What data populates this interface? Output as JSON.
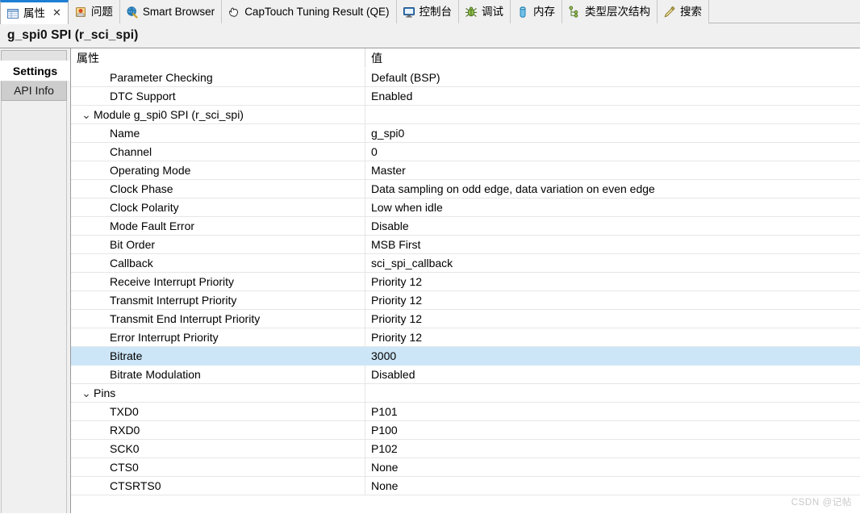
{
  "tabbar": {
    "tabs": [
      {
        "label": "属性",
        "icon": "properties-icon",
        "active": true,
        "closable": true,
        "close_glyph": "✕"
      },
      {
        "label": "问题",
        "icon": "problems-icon",
        "active": false,
        "closable": false
      },
      {
        "label": "Smart Browser",
        "icon": "globe-icon",
        "active": false,
        "closable": false
      },
      {
        "label": "CapTouch Tuning Result (QE)",
        "icon": "hand-pointer-icon",
        "active": false,
        "closable": false
      },
      {
        "label": "控制台",
        "icon": "console-icon",
        "active": false,
        "closable": false
      },
      {
        "label": "调试",
        "icon": "debug-bug-icon",
        "active": false,
        "closable": false
      },
      {
        "label": "内存",
        "icon": "memory-icon",
        "active": false,
        "closable": false
      },
      {
        "label": "类型层次结构",
        "icon": "type-hierarchy-icon",
        "active": false,
        "closable": false
      },
      {
        "label": "搜索",
        "icon": "search-icon",
        "active": false,
        "closable": false
      }
    ]
  },
  "titlebar": {
    "title": "g_spi0 SPI (r_sci_spi)"
  },
  "sidebar": {
    "tabs": [
      {
        "label": "Settings",
        "active": true
      },
      {
        "label": "API Info",
        "active": false
      }
    ]
  },
  "table": {
    "headers": {
      "property": "属性",
      "value": "值"
    },
    "rows": [
      {
        "property": "Parameter Checking",
        "value": "Default (BSP)",
        "level": 1,
        "group": false,
        "selected": false
      },
      {
        "property": "DTC Support",
        "value": "Enabled",
        "level": 1,
        "group": false,
        "selected": false
      },
      {
        "property": "Module g_spi0 SPI (r_sci_spi)",
        "value": "",
        "level": 0,
        "group": true,
        "expanded": true,
        "selected": false
      },
      {
        "property": "Name",
        "value": "g_spi0",
        "level": 1,
        "group": false,
        "selected": false
      },
      {
        "property": "Channel",
        "value": "0",
        "level": 1,
        "group": false,
        "selected": false
      },
      {
        "property": "Operating Mode",
        "value": "Master",
        "level": 1,
        "group": false,
        "selected": false
      },
      {
        "property": "Clock Phase",
        "value": "Data sampling on odd edge, data variation on even edge",
        "level": 1,
        "group": false,
        "selected": false
      },
      {
        "property": "Clock Polarity",
        "value": "Low when idle",
        "level": 1,
        "group": false,
        "selected": false
      },
      {
        "property": "Mode Fault Error",
        "value": "Disable",
        "level": 1,
        "group": false,
        "selected": false
      },
      {
        "property": "Bit Order",
        "value": "MSB First",
        "level": 1,
        "group": false,
        "selected": false
      },
      {
        "property": "Callback",
        "value": "sci_spi_callback",
        "level": 1,
        "group": false,
        "selected": false
      },
      {
        "property": "Receive Interrupt Priority",
        "value": "Priority 12",
        "level": 1,
        "group": false,
        "selected": false
      },
      {
        "property": "Transmit Interrupt Priority",
        "value": "Priority 12",
        "level": 1,
        "group": false,
        "selected": false
      },
      {
        "property": "Transmit End Interrupt Priority",
        "value": "Priority 12",
        "level": 1,
        "group": false,
        "selected": false
      },
      {
        "property": "Error Interrupt Priority",
        "value": "Priority 12",
        "level": 1,
        "group": false,
        "selected": false
      },
      {
        "property": "Bitrate",
        "value": "3000",
        "level": 1,
        "group": false,
        "selected": true
      },
      {
        "property": "Bitrate Modulation",
        "value": "Disabled",
        "level": 1,
        "group": false,
        "selected": false
      },
      {
        "property": "Pins",
        "value": "",
        "level": 0,
        "group": true,
        "expanded": true,
        "selected": false
      },
      {
        "property": "TXD0",
        "value": "P101",
        "level": 1,
        "group": false,
        "selected": false
      },
      {
        "property": "RXD0",
        "value": "P100",
        "level": 1,
        "group": false,
        "selected": false
      },
      {
        "property": "SCK0",
        "value": "P102",
        "level": 1,
        "group": false,
        "selected": false
      },
      {
        "property": "CTS0",
        "value": "None",
        "level": 1,
        "group": false,
        "selected": false
      },
      {
        "property": "CTSRTS0",
        "value": "None",
        "level": 1,
        "group": false,
        "selected": false
      }
    ],
    "twisty_glyph": "⌄"
  },
  "watermark": {
    "text": "CSDN @记帖"
  },
  "colors": {
    "selection": "#cde6f7",
    "active_tab_accent": "#1d7fd4",
    "chrome": "#f0f0f0",
    "grid_line": "#e6e6e6"
  }
}
